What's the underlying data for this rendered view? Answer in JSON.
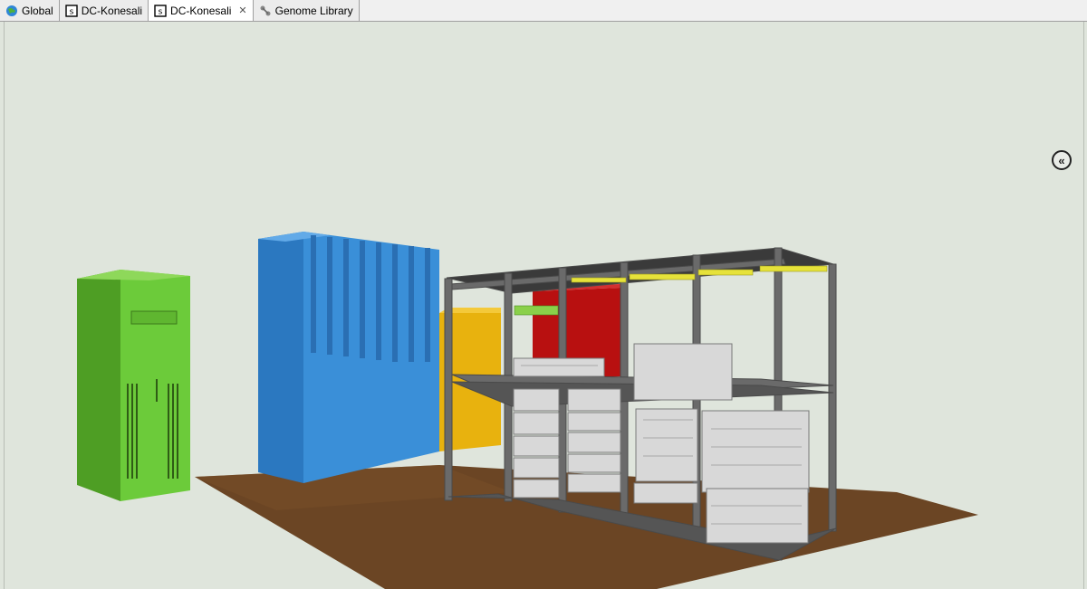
{
  "tabs": [
    {
      "label": "Global",
      "icon": "globe-icon",
      "active": false
    },
    {
      "label": "DC-Konesali",
      "icon": "s-badge-icon",
      "active": false
    },
    {
      "label": "DC-Konesali",
      "icon": "s-badge-icon",
      "active": true,
      "closable": true
    },
    {
      "label": "Genome Library",
      "icon": "gene-icon",
      "active": false
    }
  ],
  "tab_icon_letter": "s",
  "collapse_button_glyph": "«",
  "colors": {
    "background": "#dfe5dc",
    "floor": "#6b4524",
    "green_cabinet": "#6ccb3a",
    "blue_cabinet": "#3a8fd8",
    "yellow_unit": "#e8b20e",
    "red_unit": "#b81010",
    "rack_frame": "#5a5a5a",
    "accent_strip": "#e6e23a"
  }
}
